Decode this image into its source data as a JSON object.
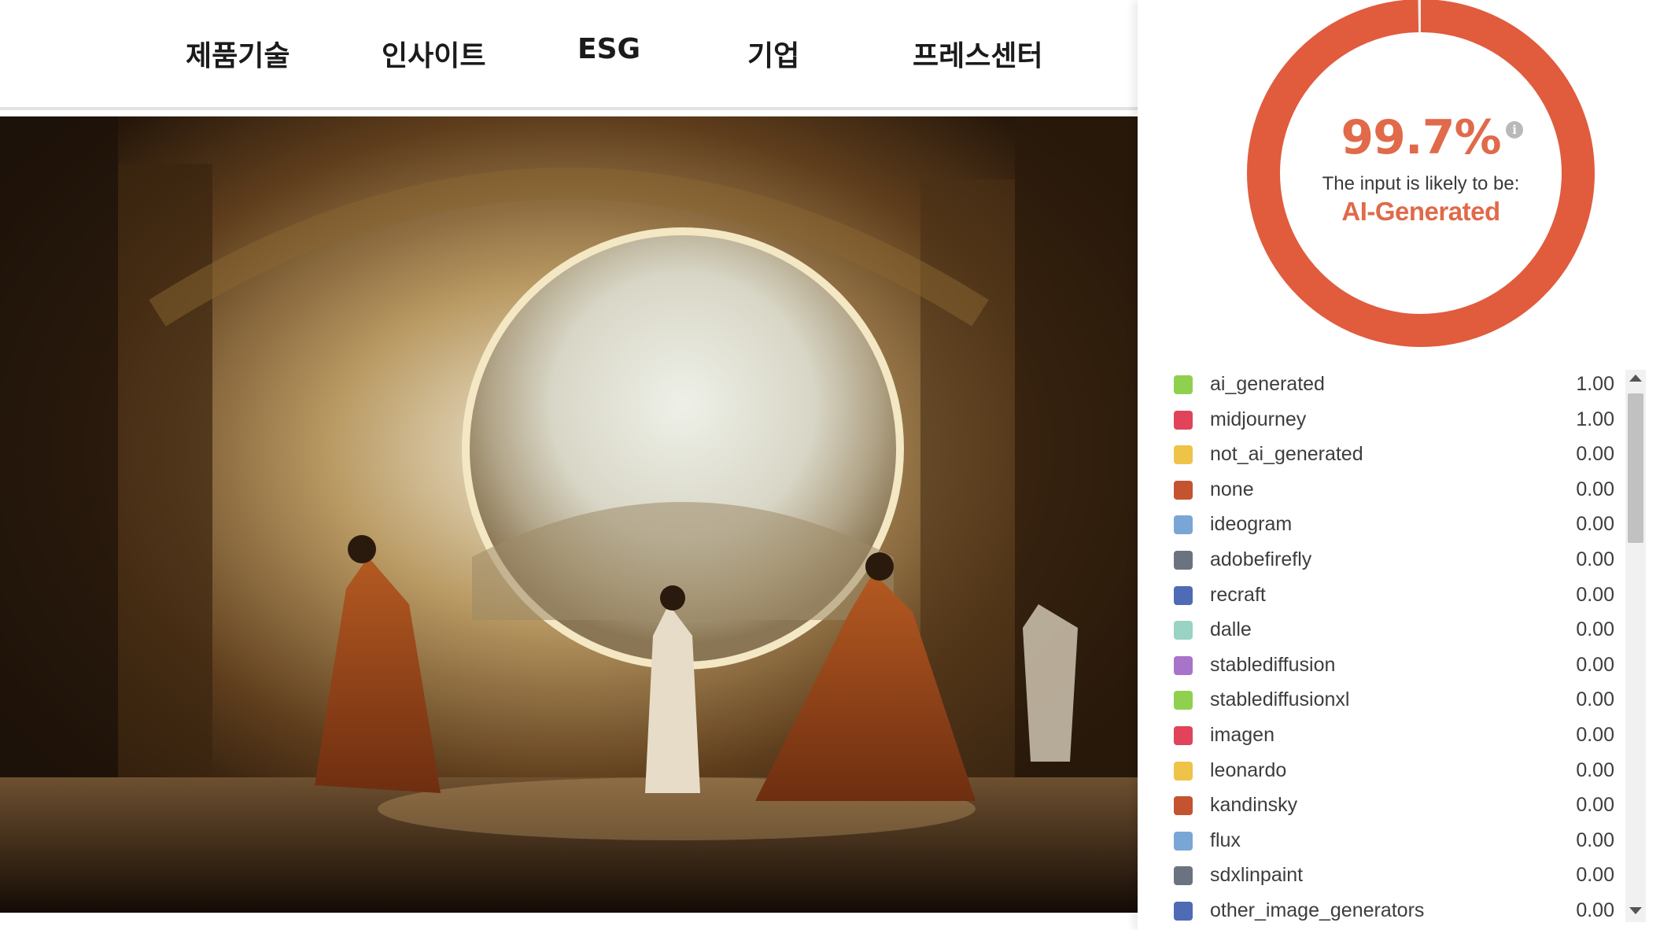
{
  "nav": {
    "items": [
      "제품기술",
      "인사이트",
      "ESG",
      "기업",
      "프레스센터"
    ]
  },
  "result": {
    "score": "99.7%",
    "likely_label": "The input is likely to be:",
    "verdict": "AI-Generated",
    "fraction": 0.997,
    "accent_color": "#e05c3d",
    "text_accent_color": "#e06a4a"
  },
  "classes": [
    {
      "name": "ai_generated",
      "value": "1.00",
      "color": "#8fd14f"
    },
    {
      "name": "midjourney",
      "value": "1.00",
      "color": "#e0435a"
    },
    {
      "name": "not_ai_generated",
      "value": "0.00",
      "color": "#efc348"
    },
    {
      "name": "none",
      "value": "0.00",
      "color": "#c4532f"
    },
    {
      "name": "ideogram",
      "value": "0.00",
      "color": "#7aa6d6"
    },
    {
      "name": "adobefirefly",
      "value": "0.00",
      "color": "#6b7380"
    },
    {
      "name": "recraft",
      "value": "0.00",
      "color": "#4f6bb6"
    },
    {
      "name": "dalle",
      "value": "0.00",
      "color": "#98d3c4"
    },
    {
      "name": "stablediffusion",
      "value": "0.00",
      "color": "#a774c9"
    },
    {
      "name": "stablediffusionxl",
      "value": "0.00",
      "color": "#8fd14f"
    },
    {
      "name": "imagen",
      "value": "0.00",
      "color": "#e0435a"
    },
    {
      "name": "leonardo",
      "value": "0.00",
      "color": "#efc348"
    },
    {
      "name": "kandinsky",
      "value": "0.00",
      "color": "#c4532f"
    },
    {
      "name": "flux",
      "value": "0.00",
      "color": "#7aa6d6"
    },
    {
      "name": "sdxlinpaint",
      "value": "0.00",
      "color": "#6b7380"
    },
    {
      "name": "other_image_generators",
      "value": "0.00",
      "color": "#4f6bb6"
    }
  ],
  "icons": {
    "info": "info-icon",
    "scroll_up": "caret-up-icon",
    "scroll_down": "caret-down-icon"
  }
}
